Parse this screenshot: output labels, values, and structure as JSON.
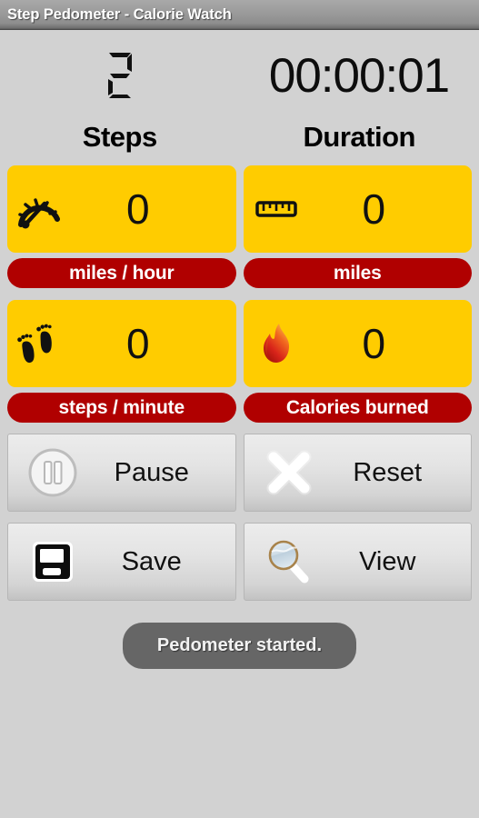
{
  "titlebar": {
    "title": "Step Pedometer - Calorie Watch"
  },
  "readout": {
    "step_count": "2",
    "step_count_style": "seven-segment",
    "timer": "00:00:01"
  },
  "headers": {
    "left": "Steps",
    "right": "Duration"
  },
  "stats": [
    {
      "icon": "speedometer-icon",
      "value": "0",
      "unit_label": "miles / hour"
    },
    {
      "icon": "ruler-icon",
      "value": "0",
      "unit_label": "miles"
    },
    {
      "icon": "footprints-icon",
      "value": "0",
      "unit_label": "steps / minute"
    },
    {
      "icon": "flame-icon",
      "value": "0",
      "unit_label": "Calories burned"
    }
  ],
  "buttons": [
    {
      "label": "Pause",
      "icon": "pause-circle-icon"
    },
    {
      "label": "Reset",
      "icon": "close-x-icon"
    },
    {
      "label": "Save",
      "icon": "floppy-disk-icon"
    },
    {
      "label": "View",
      "icon": "magnifier-icon"
    }
  ],
  "toast": {
    "message": "Pedometer started."
  },
  "colors": {
    "panel_yellow": "#FFCC00",
    "pill_red": "#B00000",
    "background": "#D2D2D2",
    "toast_gray": "#666666",
    "titlebar_gray": "#9A9A9A"
  }
}
